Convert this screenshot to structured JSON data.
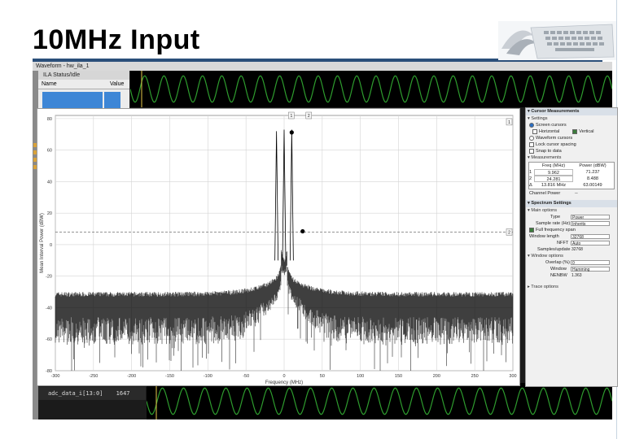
{
  "slide": {
    "title": "10MHz Input"
  },
  "waveform_window": {
    "toolbar_text": "Waveform - hw_ila_1",
    "ila_panel_title": "ILA Status/Idle",
    "columns": [
      "Name",
      "Value"
    ],
    "bottom_signal_label": "adc_data_i[13:0]",
    "bottom_signal_value": "1647",
    "wave_color": "#2e9d2e"
  },
  "chart_data": {
    "type": "line",
    "title": "",
    "xlabel": "Frequency (MHz)",
    "ylabel": "Mean Interval Power (dBW)",
    "xlim": [
      -300,
      300
    ],
    "ylim": [
      -80,
      82
    ],
    "x_ticks": [
      "-300",
      "-250",
      "-200",
      "-150",
      "-100",
      "-50",
      "0",
      "50",
      "100",
      "150",
      "200",
      "250",
      "300"
    ],
    "x_tick_values": [
      -300,
      -250,
      -200,
      -150,
      -100,
      -50,
      0,
      50,
      100,
      150,
      200,
      250,
      300
    ],
    "y_ticks": [
      "80",
      "60",
      "40",
      "20",
      "0",
      "-20",
      "-40",
      "-60",
      "-80"
    ],
    "y_tick_values": [
      80,
      60,
      40,
      20,
      0,
      -20,
      -40,
      -60,
      -80
    ],
    "grid": true,
    "peaks": [
      {
        "freq_mhz": -10,
        "power": 72
      },
      {
        "freq_mhz": 0,
        "power": 73
      },
      {
        "freq_mhz": 10,
        "power": 73
      }
    ],
    "noise_floor_dbw": -35,
    "cursor_level_dbw": 8,
    "cursors": [
      {
        "label": "1",
        "freq_mhz": 9.962,
        "power": 71.237
      },
      {
        "label": "2",
        "freq_mhz": 24.281,
        "power": 8.488
      }
    ],
    "line_color": "#000000"
  },
  "settings": {
    "cursor_section": "Cursor Measurements",
    "settings_label": "Settings",
    "screen_cursors_label": "Screen cursors",
    "horizontal_label": "Horizontal",
    "vertical_label": "Vertical",
    "waveform_cursors_label": "Waveform cursors",
    "lock_spacing_label": "Lock cursor spacing",
    "snap_label": "Snap to data",
    "measurements_label": "Measurements",
    "meas_headers": [
      "Freq (MHz)",
      "Power (dBW)"
    ],
    "meas_rows": [
      {
        "id": "1",
        "freq": "9.962",
        "power": "71.237"
      },
      {
        "id": "2",
        "freq": "24.281",
        "power": "8.488"
      },
      {
        "id": "Δ",
        "freq": "13.816 MHz",
        "power": "63.00149"
      }
    ],
    "channel_power_label": "Channel Power",
    "channel_power_value": "--",
    "spectrum_section": "Spectrum Settings",
    "main_options_label": "Main options",
    "type_label": "Type",
    "type_value": "Power",
    "sample_rate_label": "Sample rate (Hz)",
    "sample_rate_value": "Inherits",
    "full_span_label": "Full frequency span",
    "window_length_label": "Window length",
    "window_length_value": "32768",
    "nfft_label": "NFFT",
    "nfft_value": "Auto",
    "samples_update_label": "Samples/update",
    "samples_update_value": "32768",
    "window_options_label": "Window options",
    "overlap_label": "Overlap (%)",
    "overlap_value": "0",
    "window_label": "Window",
    "window_value": "Hamming",
    "nenbw_label": "NENBW",
    "nenbw_value": "1.363",
    "trace_options_label": "Trace options"
  }
}
